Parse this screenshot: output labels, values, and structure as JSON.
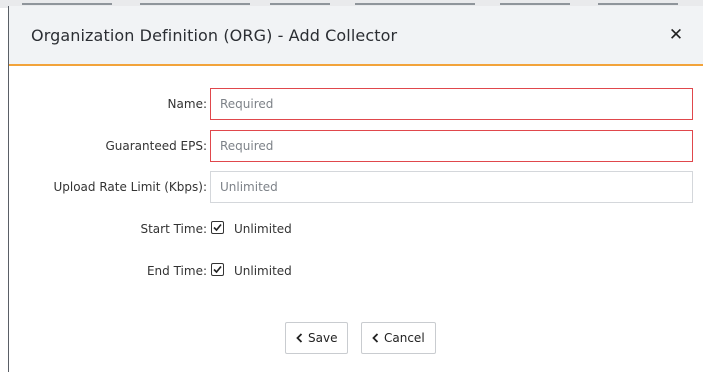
{
  "dialog": {
    "title": "Organization Definition (ORG) - Add Collector",
    "close_icon": "close-icon",
    "close_glyph": "✕"
  },
  "form": {
    "name": {
      "label": "Name:",
      "value": "",
      "placeholder": "Required",
      "required": true
    },
    "guaranteed_eps": {
      "label": "Guaranteed EPS:",
      "value": "",
      "placeholder": "Required",
      "required": true
    },
    "upload_rate_limit": {
      "label": "Upload Rate Limit (Kbps):",
      "value": "",
      "placeholder": "Unlimited",
      "required": false
    },
    "start_time": {
      "label": "Start Time:",
      "checkbox_label": "Unlimited",
      "checked": true
    },
    "end_time": {
      "label": "End Time:",
      "checkbox_label": "Unlimited",
      "checked": true
    }
  },
  "buttons": {
    "save": {
      "label": "Save",
      "icon": "chevron-left-icon"
    },
    "cancel": {
      "label": "Cancel",
      "icon": "chevron-left-icon"
    }
  },
  "colors": {
    "header_accent": "#f2a33a",
    "required_border": "#e0474c",
    "header_bg": "#f1f3f5"
  }
}
